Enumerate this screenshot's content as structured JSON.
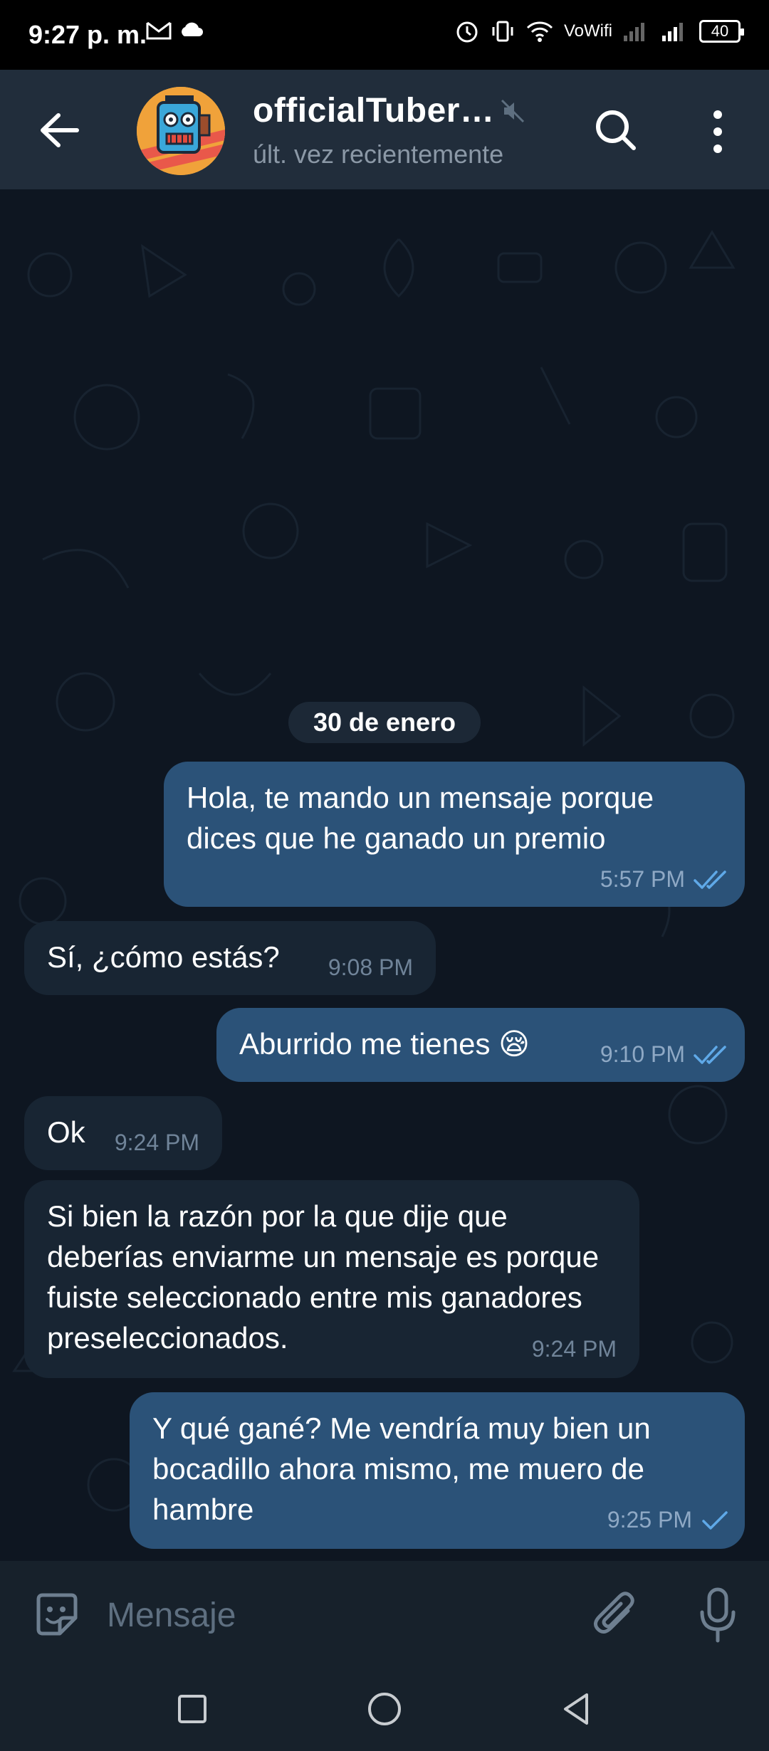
{
  "status": {
    "time": "9:27 p. m.",
    "network_label": "VoWifi",
    "battery": "40"
  },
  "header": {
    "title": "officialTuber…",
    "subtitle": "últ. vez recientemente"
  },
  "chat": {
    "date_separator": "30 de enero",
    "messages": [
      {
        "direction": "out",
        "text": "Hola, te mando un mensaje porque dices que he ganado un premio",
        "time": "5:57 PM",
        "status": "read"
      },
      {
        "direction": "in",
        "text": "Sí, ¿cómo estás?",
        "time": "9:08 PM"
      },
      {
        "direction": "out",
        "text": "Aburrido me tienes 😪",
        "time": "9:10 PM",
        "status": "read"
      },
      {
        "direction": "in",
        "text": "Ok",
        "time": "9:24 PM"
      },
      {
        "direction": "in",
        "text": "Si bien la razón por la que dije que deberías enviarme un mensaje es porque fuiste seleccionado entre mis ganadores preseleccionados.",
        "time": "9:24 PM"
      },
      {
        "direction": "out",
        "text": "Y qué gané? Me vendría muy bien un bocadillo ahora mismo, me muero de hambre",
        "time": "9:25 PM",
        "status": "sent"
      }
    ]
  },
  "input": {
    "placeholder": "Mensaje"
  },
  "colors": {
    "header_bg": "#212d3b",
    "chat_bg": "#0e1621",
    "outgoing_bubble": "#2b5278",
    "incoming_bubble": "#182533",
    "check_color": "#5fa9e8"
  },
  "icons": {
    "back": "arrow-left-icon",
    "mute": "muted-speaker-icon",
    "search": "search-icon",
    "more": "more-vertical-icon",
    "emoji": "sticker-emoji-icon",
    "attach": "paperclip-icon",
    "mic": "microphone-icon",
    "nav_recents": "square-icon",
    "nav_home": "circle-icon",
    "nav_back": "triangle-back-icon"
  }
}
